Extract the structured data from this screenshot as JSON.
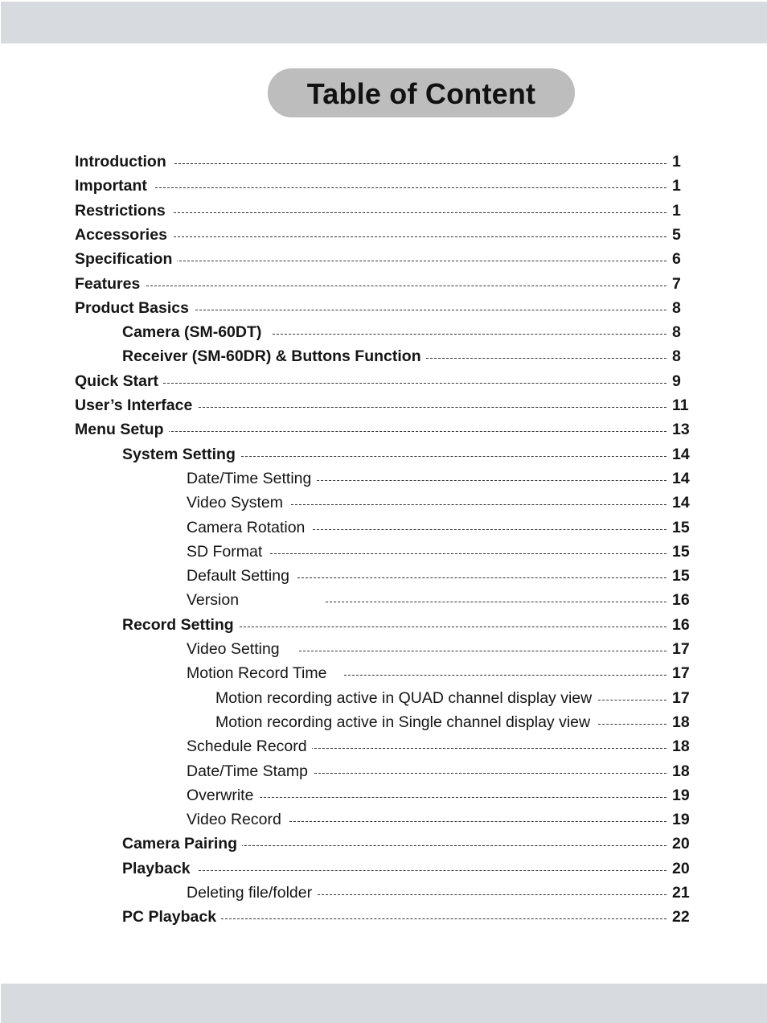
{
  "title": "Table of Content",
  "entries": [
    {
      "label": "Introduction",
      "page": "1",
      "level": 0,
      "gap": 10
    },
    {
      "label": "Important",
      "page": "1",
      "level": 0,
      "gap": 10
    },
    {
      "label": "Restrictions",
      "page": "1",
      "level": 0,
      "gap": 10
    },
    {
      "label": "Accessories",
      "page": "5",
      "level": 0,
      "gap": 8
    },
    {
      "label": "Specification",
      "page": "6",
      "level": 0,
      "gap": 4
    },
    {
      "label": "Features",
      "page": "7",
      "level": 0,
      "gap": 8
    },
    {
      "label": "Product Basics",
      "page": "8",
      "level": 0,
      "gap": 8
    },
    {
      "label": "Camera (SM-60DT)",
      "page": "8",
      "level": 1,
      "gap": 14
    },
    {
      "label": "Receiver (SM-60DR) & Buttons Function",
      "page": "8",
      "level": 1,
      "gap": 6
    },
    {
      "label": "Quick Start",
      "page": "9",
      "level": 0,
      "gap": 6
    },
    {
      "label": "User’s Interface",
      "page": "11",
      "level": 0,
      "gap": 8
    },
    {
      "label": "Menu Setup",
      "page": "13",
      "level": 0,
      "gap": 4
    },
    {
      "label": "System Setting",
      "page": "14",
      "level": 1,
      "gap": 2
    },
    {
      "label": "Date/Time Setting",
      "page": "14",
      "level": 2,
      "gap": 2
    },
    {
      "label": "Video System",
      "page": "14",
      "level": 2,
      "gap": 10
    },
    {
      "label": "Camera Rotation",
      "page": "15",
      "level": 2,
      "gap": 10
    },
    {
      "label": "SD Format",
      "page": "15",
      "level": 2,
      "gap": 10
    },
    {
      "label": "Default Setting",
      "page": "15",
      "level": 2,
      "gap": 10
    },
    {
      "label": "Version",
      "page": "16",
      "level": 2,
      "gap": 108
    },
    {
      "label": "Record Setting",
      "page": "16",
      "level": 1,
      "gap": 2
    },
    {
      "label": "Video Setting",
      "page": "17",
      "level": 2,
      "gap": 24
    },
    {
      "label": "Motion Record Time",
      "page": "17",
      "level": 2,
      "gap": 22
    },
    {
      "label": "Motion recording active in QUAD channel display view",
      "page": "17",
      "level": 3,
      "gap": 8
    },
    {
      "label": "Motion recording active in Single channel display view",
      "page": "18",
      "level": 3,
      "gap": 10
    },
    {
      "label": "Schedule Record",
      "page": "18",
      "level": 2,
      "gap": 4
    },
    {
      "label": "Date/Time Stamp",
      "page": "18",
      "level": 2,
      "gap": 8
    },
    {
      "label": "Overwrite",
      "page": "19",
      "level": 2,
      "gap": 8
    },
    {
      "label": "Video Record",
      "page": "19",
      "level": 2,
      "gap": 10
    },
    {
      "label": "Camera Pairing",
      "page": "20",
      "level": 1,
      "gap": 4
    },
    {
      "label": "Playback",
      "page": "20",
      "level": 1,
      "gap": 10
    },
    {
      "label": "Deleting file/folder",
      "page": "21",
      "level": 2,
      "gap": 2
    },
    {
      "label": "PC Playback",
      "page": "22",
      "level": 1,
      "gap": 6
    }
  ]
}
